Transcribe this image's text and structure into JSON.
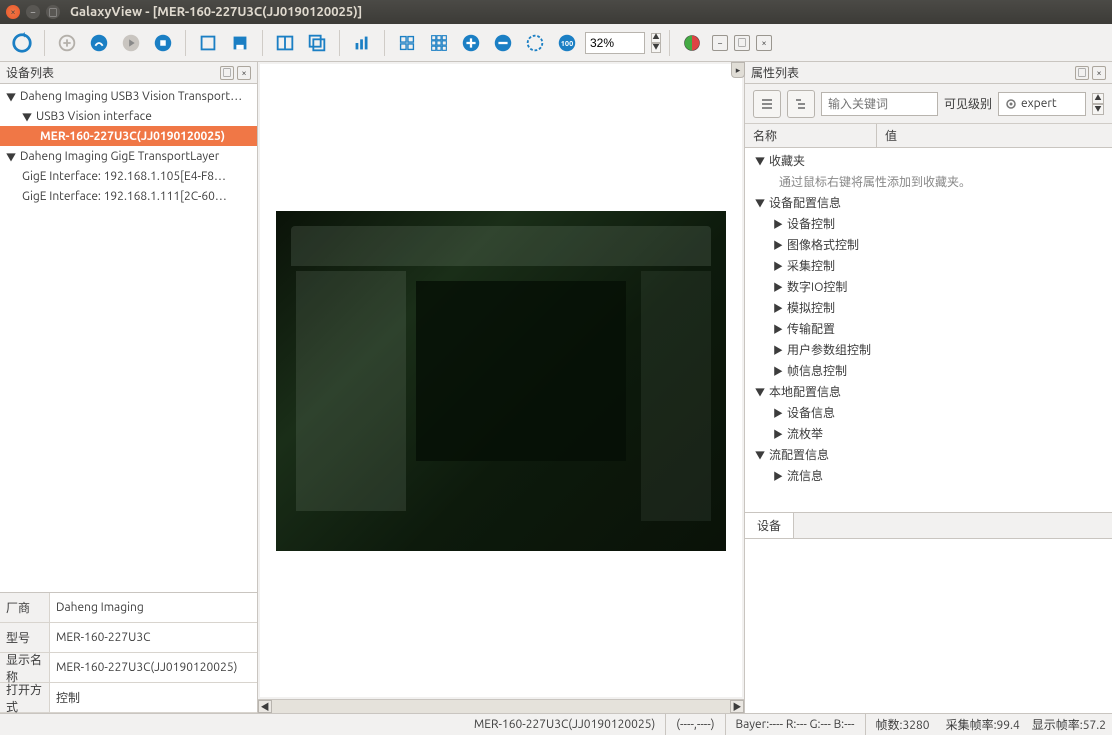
{
  "window": {
    "title": "GalaxyView - [MER-160-227U3C(JJ0190120025)]"
  },
  "toolbar": {
    "zoom_value": "32%"
  },
  "left": {
    "title": "设备列表",
    "tree": [
      {
        "label": "Daheng Imaging USB3 Vision Transport…",
        "indent": 0,
        "tw": "▼"
      },
      {
        "label": "USB3 Vision interface",
        "indent": 1,
        "tw": "▼"
      },
      {
        "label": "MER-160-227U3C(JJ0190120025)",
        "indent": 2,
        "tw": "",
        "sel": true
      },
      {
        "label": "Daheng Imaging GigE TransportLayer",
        "indent": 0,
        "tw": "▼"
      },
      {
        "label": "GigE Interface: 192.168.1.105[E4-F8…",
        "indent": 1,
        "tw": ""
      },
      {
        "label": "GigE Interface: 192.168.1.111[2C-60…",
        "indent": 1,
        "tw": ""
      }
    ],
    "info": [
      {
        "label": "厂商",
        "value": "Daheng Imaging"
      },
      {
        "label": "型号",
        "value": "MER-160-227U3C"
      },
      {
        "label": "显示名称",
        "value": "MER-160-227U3C(JJ0190120025)"
      },
      {
        "label": "打开方式",
        "value": "控制"
      }
    ]
  },
  "right": {
    "title": "属性列表",
    "search_placeholder": "输入关键词",
    "vis_label": "可见级别",
    "vis_value": "expert",
    "col_name": "名称",
    "col_value": "值",
    "tree": [
      {
        "tw": "▼",
        "label": "收藏夹",
        "indent": 0
      },
      {
        "tw": "",
        "label": "通过鼠标右键将属性添加到收藏夹。",
        "indent": 0,
        "hint": true
      },
      {
        "tw": "▼",
        "label": "设备配置信息",
        "indent": 0
      },
      {
        "tw": "▶",
        "label": "设备控制",
        "indent": 1
      },
      {
        "tw": "▶",
        "label": "图像格式控制",
        "indent": 1
      },
      {
        "tw": "▶",
        "label": "采集控制",
        "indent": 1
      },
      {
        "tw": "▶",
        "label": "数字IO控制",
        "indent": 1
      },
      {
        "tw": "▶",
        "label": "模拟控制",
        "indent": 1
      },
      {
        "tw": "▶",
        "label": "传输配置",
        "indent": 1
      },
      {
        "tw": "▶",
        "label": "用户参数组控制",
        "indent": 1
      },
      {
        "tw": "▶",
        "label": "帧信息控制",
        "indent": 1
      },
      {
        "tw": "▼",
        "label": "本地配置信息",
        "indent": 0
      },
      {
        "tw": "▶",
        "label": "设备信息",
        "indent": 1
      },
      {
        "tw": "▶",
        "label": "流枚举",
        "indent": 1
      },
      {
        "tw": "▼",
        "label": "流配置信息",
        "indent": 0
      },
      {
        "tw": "▶",
        "label": "流信息",
        "indent": 1
      }
    ],
    "tab": "设备"
  },
  "status": {
    "device": "MER-160-227U3C(JJ0190120025)",
    "coords": "(----,----)",
    "bayer": "Bayer:---- R:--- G:--- B:---",
    "frames": "帧数:3280",
    "acq_fps": "采集帧率:99.4",
    "disp_fps": "显示帧率:57.2"
  }
}
